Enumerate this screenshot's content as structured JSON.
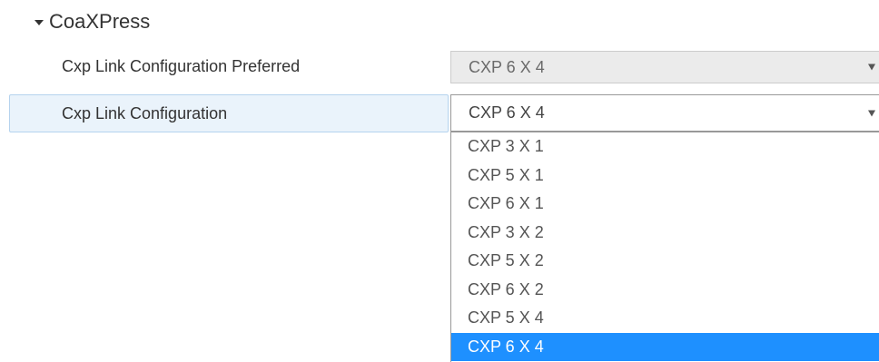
{
  "section": {
    "title": "CoaXPress"
  },
  "rows": {
    "preferred": {
      "label": "Cxp Link Configuration Preferred",
      "value": "CXP 6 X 4"
    },
    "config": {
      "label": "Cxp Link Configuration",
      "value": "CXP 6 X 4"
    }
  },
  "dropdown": {
    "options": [
      "CXP 3 X 1",
      "CXP 5 X 1",
      "CXP 6 X 1",
      "CXP 3 X 2",
      "CXP 5 X 2",
      "CXP 6 X 2",
      "CXP 5 X 4",
      "CXP 6 X 4"
    ],
    "selected": "CXP 6 X 4"
  },
  "colors": {
    "highlight_row": "#eaf3fb",
    "selected_option": "#1e90ff",
    "disabled_field": "#ebebeb"
  }
}
